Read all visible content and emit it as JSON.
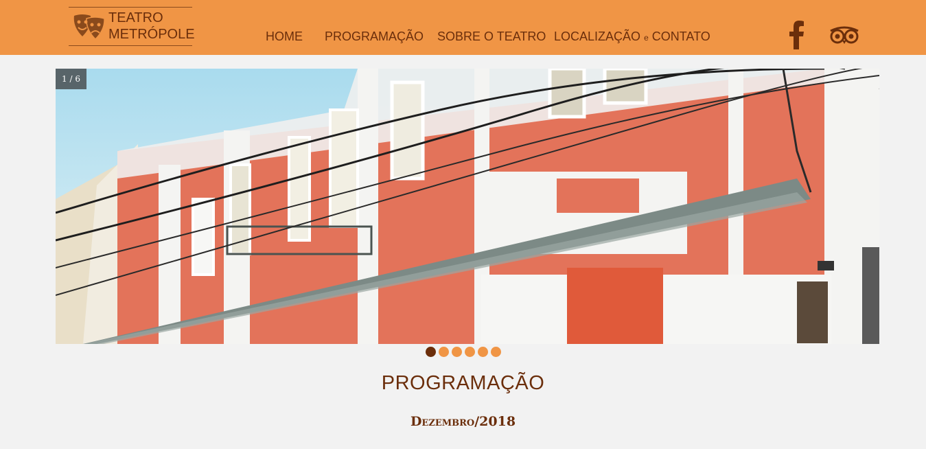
{
  "header": {
    "logo": {
      "line1": "TEATRO",
      "line2": "METRÓPOLE"
    },
    "nav": [
      {
        "label": "HOME"
      },
      {
        "label": "PROGRAMAÇÃO"
      },
      {
        "label": "SOBRE O TEATRO"
      },
      {
        "label_a": "LOCALIZAÇÃO",
        "label_b": "e",
        "label_c": "CONTATO"
      }
    ],
    "social": {
      "facebook_icon": "facebook-icon",
      "tripadvisor_icon": "tripadvisor-icon"
    }
  },
  "slider": {
    "counter": "1 / 6",
    "total": 6,
    "active": 1
  },
  "colors": {
    "header": "#f09545",
    "text": "#6b2e0b",
    "background": "#f2f2f2"
  },
  "section": {
    "title": "PROGRAMAÇÃO",
    "subtitle": "Dezembro/2018"
  }
}
